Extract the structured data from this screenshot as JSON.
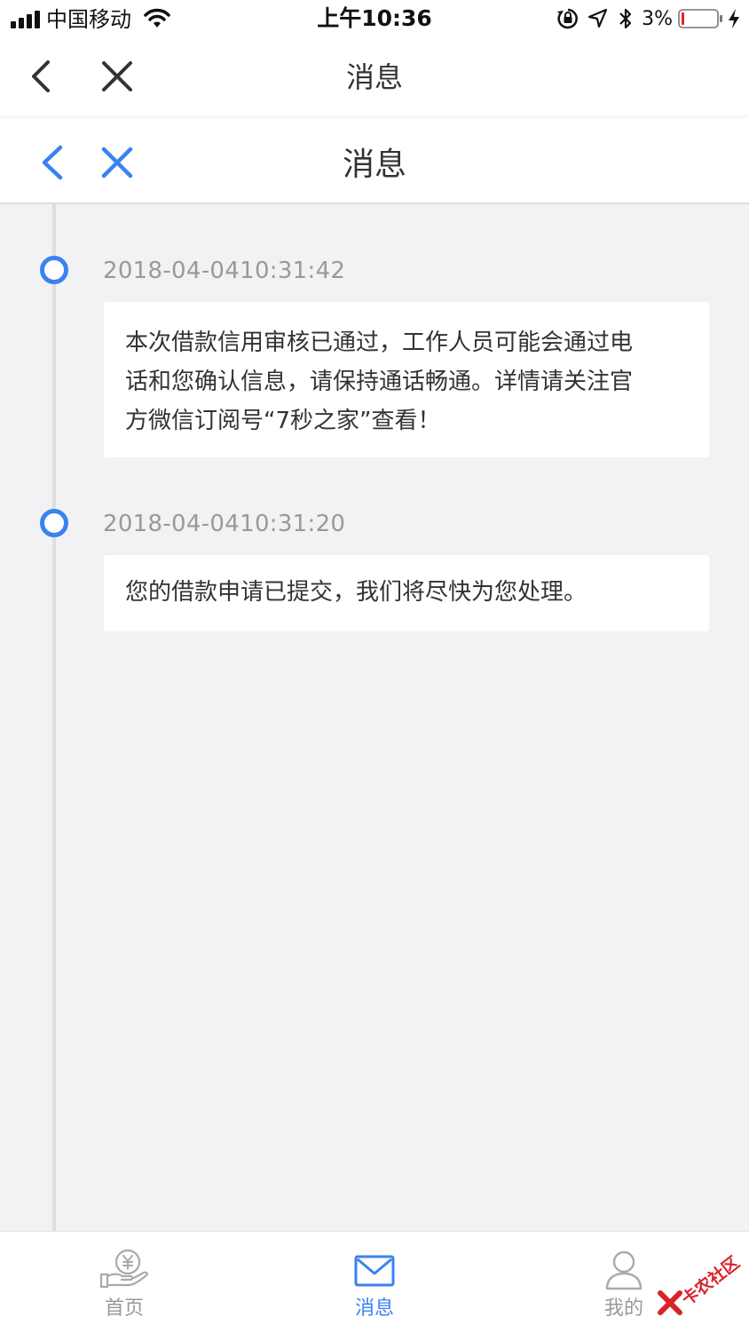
{
  "status_bar": {
    "carrier": "中国移动",
    "time": "上午10:36",
    "battery_percent": "3%",
    "icons": [
      "signal-icon",
      "wifi-icon",
      "orientation-lock-icon",
      "location-icon",
      "bluetooth-icon",
      "battery-icon",
      "charging-icon"
    ]
  },
  "outer_nav": {
    "title": "消息",
    "icons": [
      "back-icon",
      "close-icon"
    ],
    "icon_color": "#333333"
  },
  "inner_nav": {
    "title": "消息",
    "icons": [
      "back-icon",
      "close-icon"
    ],
    "icon_color": "#3a82f0"
  },
  "timeline": {
    "items": [
      {
        "timestamp": "2018-04-0410:31:42",
        "lines": [
          "本次借款信用审核已通过，工作人员可能会通过电",
          "话和您确认信息，请保持通话畅通。详情请关注官",
          "方微信订阅号“7秒之家”查看！"
        ]
      },
      {
        "timestamp": "2018-04-0410:31:20",
        "lines": [
          "您的借款申请已提交，我们将尽快为您处理。"
        ]
      }
    ]
  },
  "tab_bar": {
    "tabs": [
      {
        "label": "首页",
        "icon": "loan-hand-yuan-icon",
        "active": false
      },
      {
        "label": "消息",
        "icon": "envelope-icon",
        "active": true
      },
      {
        "label": "我的",
        "icon": "user-icon",
        "active": false
      }
    ]
  },
  "watermark": {
    "text": "卡农社区"
  },
  "colors": {
    "accent": "#3a82f0",
    "background": "#f2f2f4",
    "card": "#ffffff",
    "timestamp": "#999999",
    "body_text": "#333333",
    "watermark": "#d8232a"
  }
}
